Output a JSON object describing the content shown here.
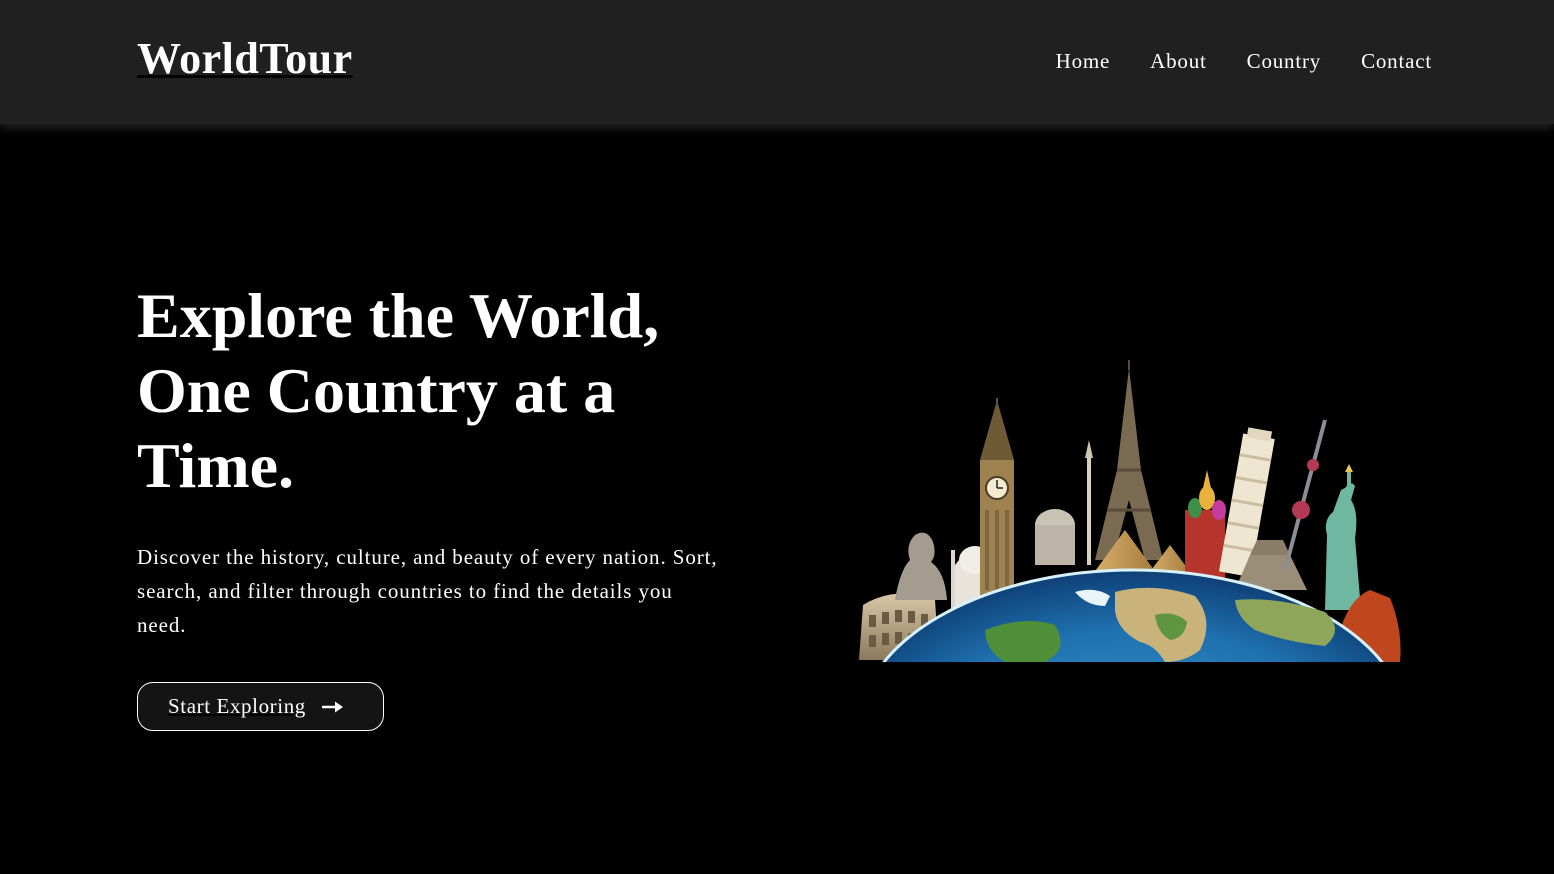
{
  "navbar": {
    "logo": "WorldTour",
    "links": [
      {
        "label": "Home"
      },
      {
        "label": "About"
      },
      {
        "label": "Country"
      },
      {
        "label": "Contact"
      }
    ]
  },
  "hero": {
    "title_line1": "Explore the World,",
    "title_line2": "One Country at a",
    "title_line3": "Time.",
    "description": "Discover the history, culture, and beauty of every nation. Sort, search, and filter through countries to find the details you need.",
    "cta_label": "Start Exploring",
    "cta_icon": "arrow-right-icon",
    "image": "globe-with-landmarks-illustration"
  },
  "colors": {
    "background": "#000000",
    "navbar": "#202020",
    "text": "#ffffff",
    "button_bg": "#141414"
  }
}
